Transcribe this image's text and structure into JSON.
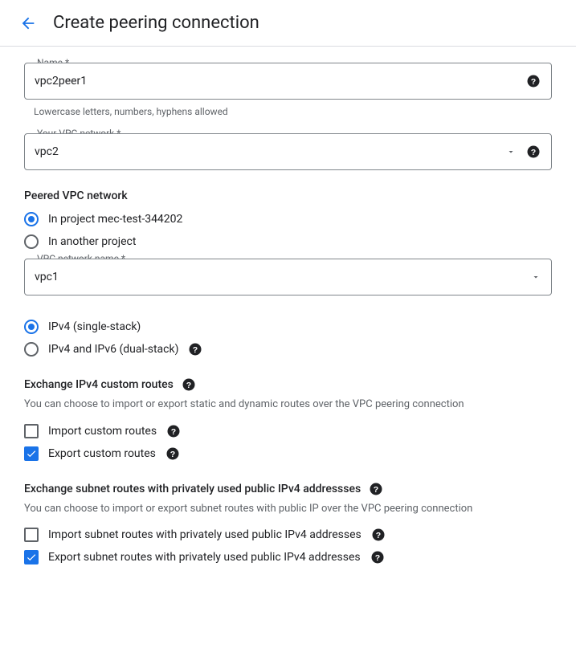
{
  "header": {
    "title": "Create peering connection"
  },
  "name_field": {
    "label": "Name *",
    "value": "vpc2peer1",
    "helper": "Lowercase letters, numbers, hyphens allowed"
  },
  "your_vpc_field": {
    "label": "Your VPC network *",
    "value": "vpc2"
  },
  "peered_section": {
    "title": "Peered VPC network",
    "radio_in_project": "In project mec-test-344202",
    "radio_another": "In another project",
    "vpc_name_label": "VPC network name *",
    "vpc_name_value": "vpc1"
  },
  "stack_section": {
    "radio_ipv4": "IPv4 (single-stack)",
    "radio_dual": "IPv4 and IPv6 (dual-stack)"
  },
  "custom_routes": {
    "title": "Exchange IPv4 custom routes",
    "desc": "You can choose to import or export static and dynamic routes over the VPC peering connection",
    "import_label": "Import custom routes",
    "export_label": "Export custom routes"
  },
  "subnet_routes": {
    "title": "Exchange subnet routes with privately used public IPv4 addressses",
    "desc": "You can choose to import or export subnet routes with public IP over the VPC peering connection",
    "import_label": "Import subnet routes with privately used public IPv4 addresses",
    "export_label": "Export subnet routes with privately used public IPv4 addresses"
  }
}
